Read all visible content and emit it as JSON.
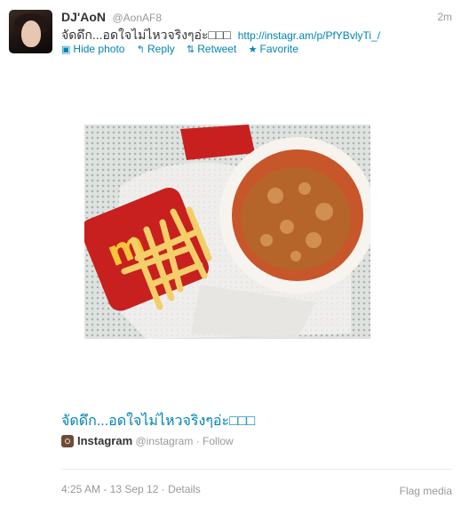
{
  "tweet": {
    "author_name": "DJ'AoN",
    "screen_name": "@AonAF8",
    "time_ago": "2m",
    "text": "จัดดึก...อดใจไม่ไหวจริงๆอ่ะ□□□",
    "link_text": "http://instagr.am/p/PfYBvlyTi_/"
  },
  "actions": [
    {
      "icon": "picture-icon",
      "glyph": "▣",
      "label": "Hide photo"
    },
    {
      "icon": "reply-icon",
      "glyph": "↰",
      "label": "Reply"
    },
    {
      "icon": "retweet-icon",
      "glyph": "⇅",
      "label": "Retweet"
    },
    {
      "icon": "star-icon",
      "glyph": "★",
      "label": "Favorite"
    }
  ],
  "card": {
    "title": "จัดดึก...อดใจไม่ไหวจริงๆอ่ะ□□□",
    "source_name": "Instagram",
    "source_handle": "@instagram",
    "separator": "·",
    "follow_label": "Follow"
  },
  "footer": {
    "timestamp": "4:25 AM - 13 Sep 12",
    "separator": "·",
    "details_label": "Details",
    "flag_label": "Flag media"
  },
  "colors": {
    "link": "#0084b4",
    "text": "#333333",
    "muted": "#999999",
    "fries_box": "#c8201e",
    "fries": "#f3cf6a",
    "chicken": "#b5652a"
  }
}
